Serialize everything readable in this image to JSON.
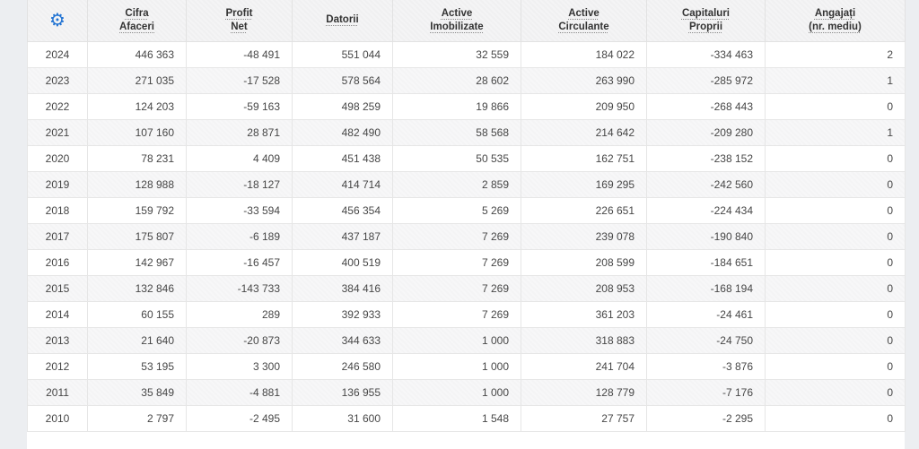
{
  "accent_color": "#2173d3",
  "table": {
    "settings_icon_glyph": "⚙",
    "headers": [
      "Cifra\nAfaceri",
      "Profit\nNet",
      "Datorii",
      "Active\nImobilizate",
      "Active\nCirculante",
      "Capitaluri\nProprii",
      "Angajați\n(nr. mediu)"
    ],
    "rows": [
      {
        "year": "2024",
        "values": [
          "446 363",
          "-48 491",
          "551 044",
          "32 559",
          "184 022",
          "-334 463",
          "2"
        ]
      },
      {
        "year": "2023",
        "values": [
          "271 035",
          "-17 528",
          "578 564",
          "28 602",
          "263 990",
          "-285 972",
          "1"
        ]
      },
      {
        "year": "2022",
        "values": [
          "124 203",
          "-59 163",
          "498 259",
          "19 866",
          "209 950",
          "-268 443",
          "0"
        ]
      },
      {
        "year": "2021",
        "values": [
          "107 160",
          "28 871",
          "482 490",
          "58 568",
          "214 642",
          "-209 280",
          "1"
        ]
      },
      {
        "year": "2020",
        "values": [
          "78 231",
          "4 409",
          "451 438",
          "50 535",
          "162 751",
          "-238 152",
          "0"
        ]
      },
      {
        "year": "2019",
        "values": [
          "128 988",
          "-18 127",
          "414 714",
          "2 859",
          "169 295",
          "-242 560",
          "0"
        ]
      },
      {
        "year": "2018",
        "values": [
          "159 792",
          "-33 594",
          "456 354",
          "5 269",
          "226 651",
          "-224 434",
          "0"
        ]
      },
      {
        "year": "2017",
        "values": [
          "175 807",
          "-6 189",
          "437 187",
          "7 269",
          "239 078",
          "-190 840",
          "0"
        ]
      },
      {
        "year": "2016",
        "values": [
          "142 967",
          "-16 457",
          "400 519",
          "7 269",
          "208 599",
          "-184 651",
          "0"
        ]
      },
      {
        "year": "2015",
        "values": [
          "132 846",
          "-143 733",
          "384 416",
          "7 269",
          "208 953",
          "-168 194",
          "0"
        ]
      },
      {
        "year": "2014",
        "values": [
          "60 155",
          "289",
          "392 933",
          "7 269",
          "361 203",
          "-24 461",
          "0"
        ]
      },
      {
        "year": "2013",
        "values": [
          "21 640",
          "-20 873",
          "344 633",
          "1 000",
          "318 883",
          "-24 750",
          "0"
        ]
      },
      {
        "year": "2012",
        "values": [
          "53 195",
          "3 300",
          "246 580",
          "1 000",
          "241 704",
          "-3 876",
          "0"
        ]
      },
      {
        "year": "2011",
        "values": [
          "35 849",
          "-4 881",
          "136 955",
          "1 000",
          "128 779",
          "-7 176",
          "0"
        ]
      },
      {
        "year": "2010",
        "values": [
          "2 797",
          "-2 495",
          "31 600",
          "1 548",
          "27 757",
          "-2 295",
          "0"
        ]
      }
    ]
  }
}
